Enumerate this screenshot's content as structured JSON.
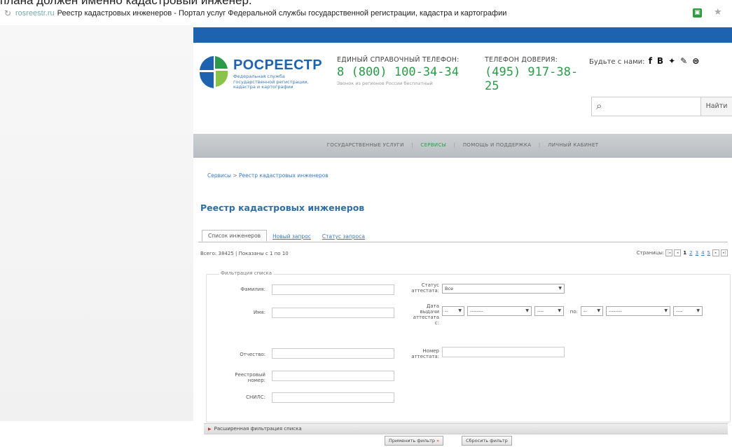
{
  "top_clip": {
    "text": "плана должен именно кадастровый инженер."
  },
  "browser": {
    "domain": "rosreestr.ru",
    "title": "Реестр кадастровых инженеров - Портал услуг Федеральной службы государственной регистрации, кадастра и картографии"
  },
  "header": {
    "logo_title": "РОСРЕЕСТР",
    "logo_subtitle": "Федеральная служба государственной регистрации, кадастра и картографии",
    "phone1_label": "ЕДИНЫЙ СПРАВОЧНЫЙ ТЕЛЕФОН:",
    "phone1_number": "8 (800) 100-34-34",
    "phone1_note": "Звонок из регионов России бесплатный",
    "phone2_label": "ТЕЛЕФОН ДОВЕРИЯ:",
    "phone2_number": "(495) 917-38-25",
    "social_label": "Будьте с нами:",
    "search_placeholder": "",
    "search_button": "Найти"
  },
  "nav": {
    "items": [
      {
        "label": "ГОСУДАРСТВЕННЫЕ УСЛУГИ",
        "active": false
      },
      {
        "label": "СЕРВИСЫ",
        "active": true
      },
      {
        "label": "ПОМОЩЬ И ПОДДЕРЖКА",
        "active": false
      },
      {
        "label": "ЛИЧНЫЙ КАБИНЕТ",
        "active": false
      }
    ]
  },
  "breadcrumb": {
    "root": "Сервисы",
    "sep": ">",
    "current": "Реестр кадастровых инженеров"
  },
  "page": {
    "title": "Реестр кадастровых инженеров"
  },
  "tabs": [
    {
      "label": "Список инженеров",
      "active": true
    },
    {
      "label": "Новый запрос",
      "active": false
    },
    {
      "label": "Статус запроса",
      "active": false
    }
  ],
  "list": {
    "counts": "Всего: 38425 | Показаны с 1 по 10",
    "pager_label": "Страницы:",
    "pages": [
      "1",
      "2",
      "3",
      "4",
      "5"
    ]
  },
  "filter": {
    "legend": "Фильтрация списка",
    "surname_label": "Фамилия:",
    "name_label": "Имя:",
    "patronymic_label": "Отчество:",
    "registry_label": "Реестровый номер:",
    "snils_label": "СНИЛС:",
    "status_label": "Статус аттестата:",
    "status_value": "Все",
    "date_label": "Дата выдачи аттестата с:",
    "day_value": "--",
    "month_value": "--------",
    "year_value": "----",
    "po_label": "по:",
    "cert_label": "Номер аттестата:"
  },
  "extended": {
    "label": "Расширенная фильтрация списка"
  },
  "buttons": {
    "apply": "Применить фильтр",
    "reset": "Сбросить фильтр"
  }
}
